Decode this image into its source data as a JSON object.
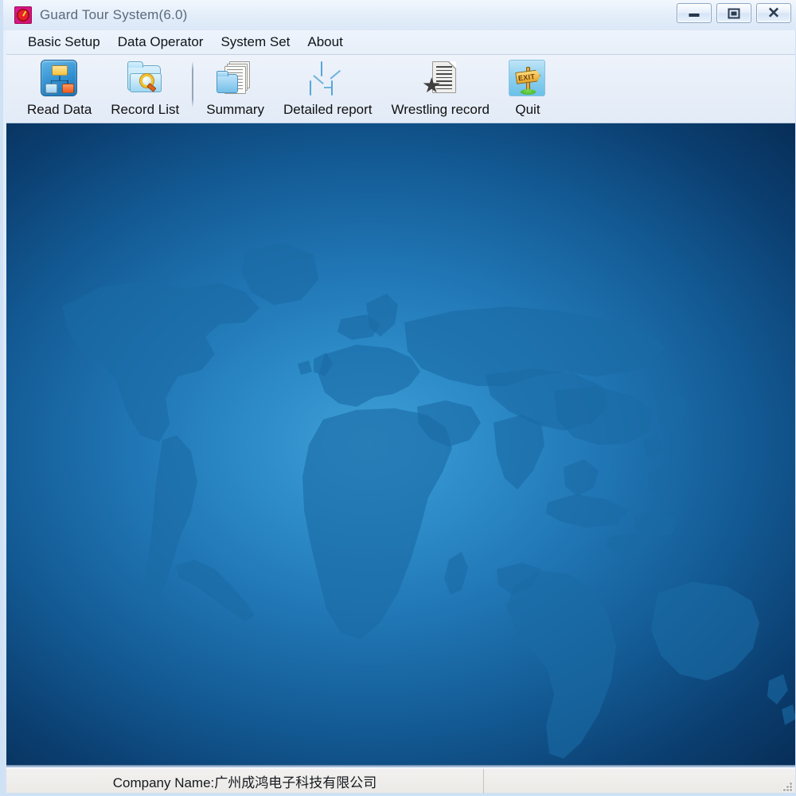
{
  "window": {
    "title": "Guard Tour System(6.0)",
    "icon": "clock-icon",
    "controls": {
      "minimize": "Minimize",
      "restore": "Restore",
      "close": "Close"
    }
  },
  "menu": {
    "items": [
      {
        "label": "Basic Setup",
        "name": "menu-basic-setup"
      },
      {
        "label": "Data Operator",
        "name": "menu-data-operator"
      },
      {
        "label": "System Set",
        "name": "menu-system-set"
      },
      {
        "label": "About",
        "name": "menu-about"
      }
    ]
  },
  "toolbar": {
    "buttons": [
      {
        "label": "Read Data",
        "icon": "hierarchy-icon"
      },
      {
        "label": "Record List",
        "icon": "folder-search-icon"
      },
      {
        "label": "Summary",
        "icon": "documents-folder-icon"
      },
      {
        "label": "Detailed report",
        "icon": "network-computers-icon"
      },
      {
        "label": "Wrestling record",
        "icon": "document-star-icon"
      },
      {
        "label": "Quit",
        "icon": "exit-sign-icon"
      }
    ]
  },
  "main": {
    "background": "world-map-blue-gradient",
    "colors": {
      "center": "#3f9fd6",
      "mid": "#1f74b2",
      "edge": "#072c55",
      "landmass": "#1b6ba4"
    }
  },
  "status": {
    "company_label": "Company Name:广州成鸿电子科技有限公司",
    "right_panel": ""
  }
}
